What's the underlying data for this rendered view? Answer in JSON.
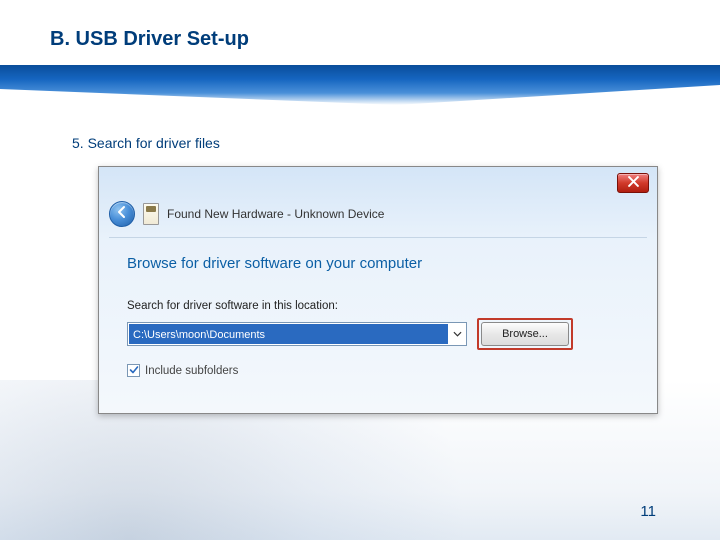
{
  "slide": {
    "title": "B. USB Driver Set-up",
    "step": "5. Search for driver files",
    "page_number": "11"
  },
  "dialog": {
    "window_title": "Found New Hardware - Unknown Device",
    "heading": "Browse for driver software on your computer",
    "search_label": "Search for driver software in this location:",
    "path_value": "C:\\Users\\moon\\Documents",
    "browse_button": "Browse...",
    "include_subfolders": "Include subfolders",
    "include_subfolders_checked": true
  }
}
